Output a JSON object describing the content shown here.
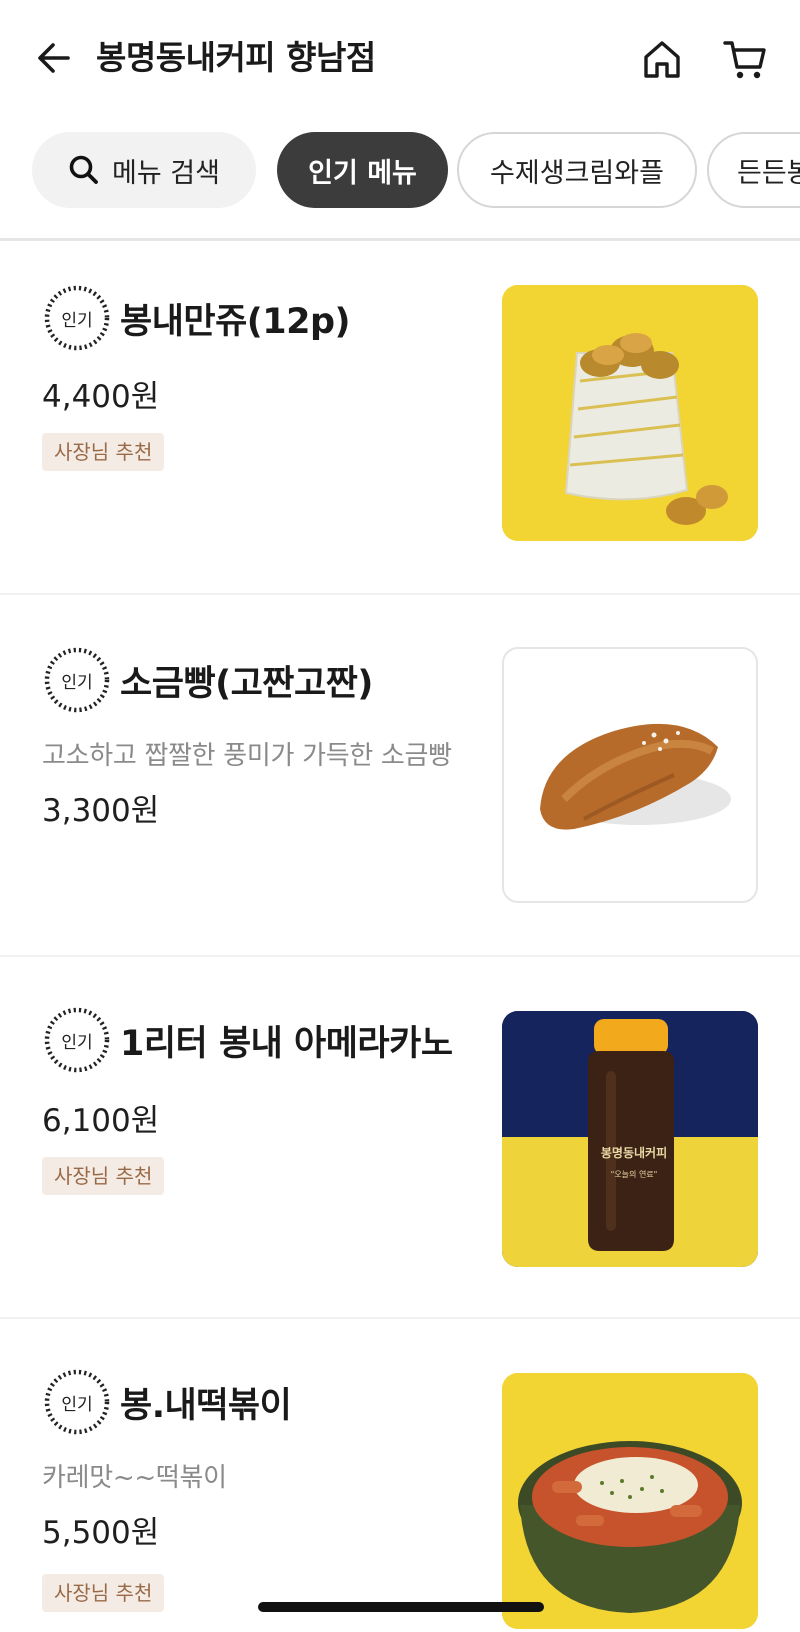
{
  "header": {
    "title": "봉명동내커피 향남점",
    "back_icon": "arrow-left-icon",
    "home_icon": "home-icon",
    "cart_icon": "cart-icon"
  },
  "chips": {
    "search_label": "메뉴 검색",
    "active_label": "인기 메뉴",
    "chip3_label": "수제생크림와플",
    "chip4_label": "든든봉"
  },
  "items": [
    {
      "badge": "인기",
      "name": "봉내만쥬(12p)",
      "price": "4,400원",
      "tag": "사장님 추천"
    },
    {
      "badge": "인기",
      "name": "소금빵(고짠고짠)",
      "description": "고소하고 짭짤한 풍미가 가득한 소금빵",
      "price": "3,300원"
    },
    {
      "badge": "인기",
      "name": "1리터 봉내 아메라카노",
      "price": "6,100원",
      "tag": "사장님 추천",
      "bottle_label": "봉명동내커피",
      "bottle_sub": "\"오늘의 연료\""
    },
    {
      "badge": "인기",
      "name": "봉.내떡볶이",
      "description": "카레맛~~떡볶이",
      "price": "5,500원",
      "tag": "사장님 추천"
    }
  ],
  "colors": {
    "accent_dark": "#3c3c3c",
    "tag_bg": "#f4ece4",
    "tag_text": "#9a6a48",
    "thumb_yellow": "#f2d433",
    "thumb_navy": "#16245e"
  }
}
